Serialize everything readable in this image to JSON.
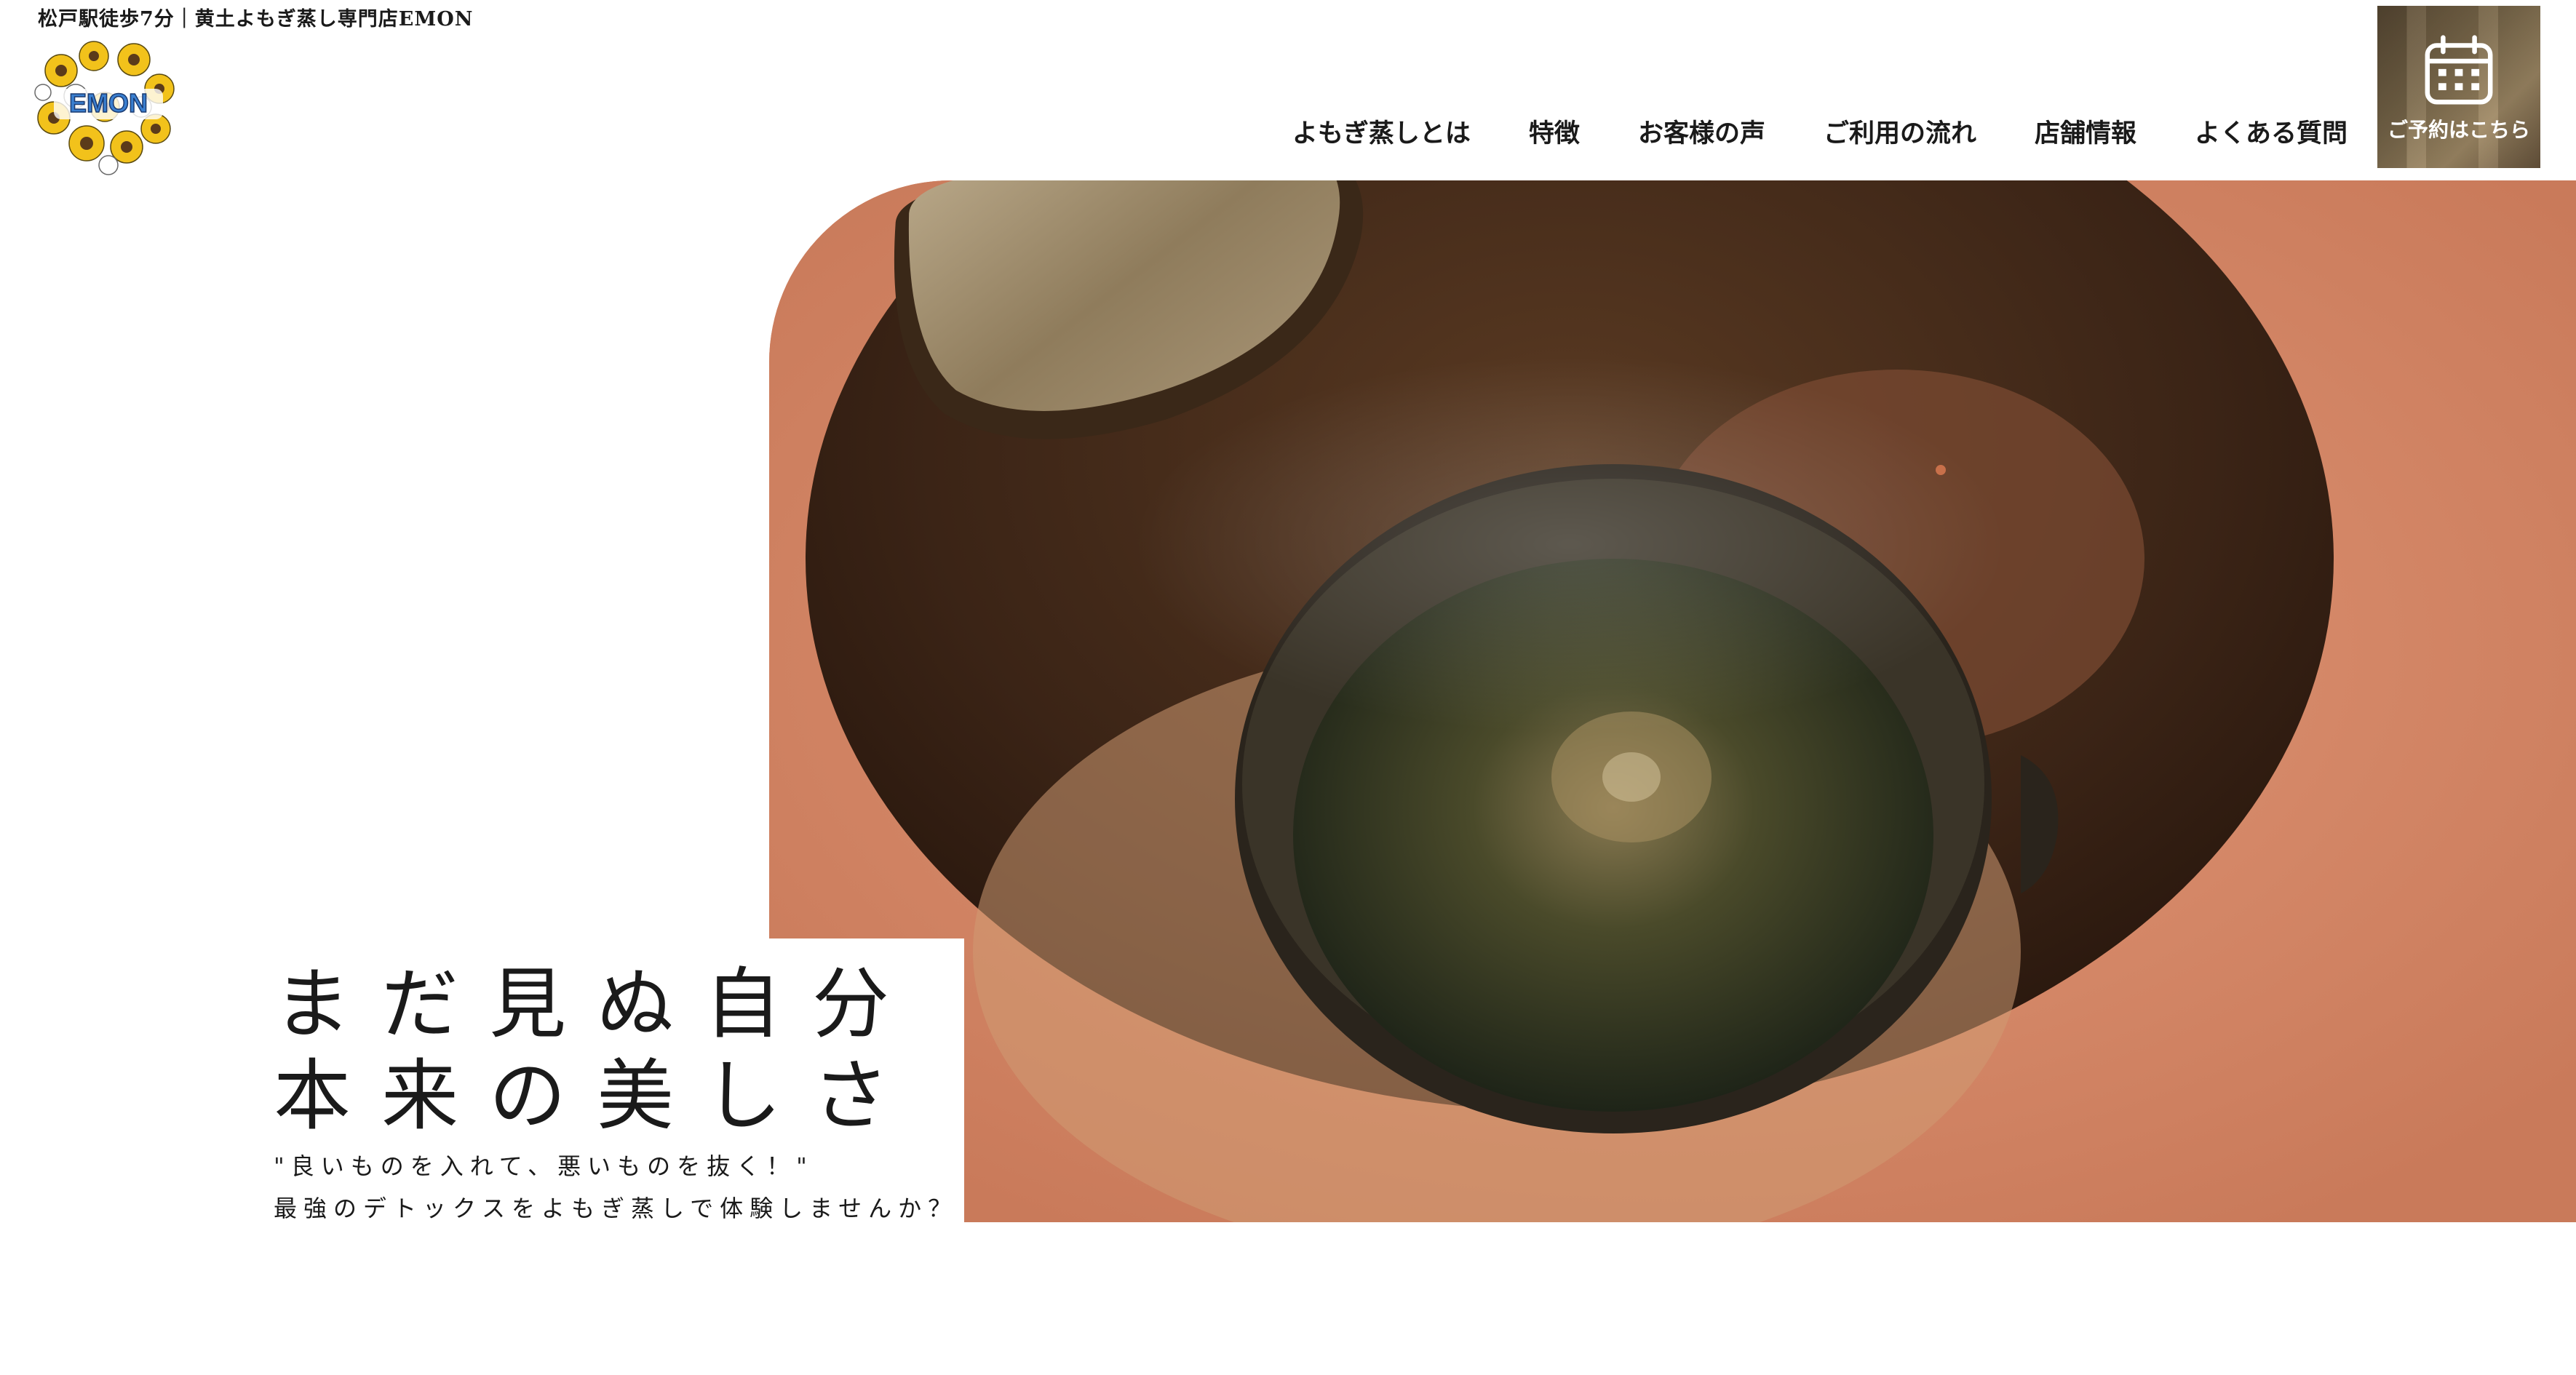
{
  "header": {
    "tagline": "松戸駅徒歩7分｜黄土よもぎ蒸し専門店EMON",
    "logo_text": "EMON"
  },
  "nav": {
    "items": [
      "よもぎ蒸しとは",
      "特徴",
      "お客様の声",
      "ご利用の流れ",
      "店舗情報",
      "よくある質問"
    ]
  },
  "cta": {
    "label": "ご予約はこちら",
    "icon": "calendar-icon"
  },
  "hero": {
    "headline_line1": "まだ見ぬ自分",
    "headline_line2": "本来の美しさ",
    "sub_line1": "\"良いものを入れて、悪いものを抜く！\"",
    "sub_line2": "最強のデトックスをよもぎ蒸しで体験しませんか？"
  },
  "colors": {
    "accent": "#d48a69",
    "text": "#1a1a1a",
    "cta_bg": "#7c6a4c"
  }
}
